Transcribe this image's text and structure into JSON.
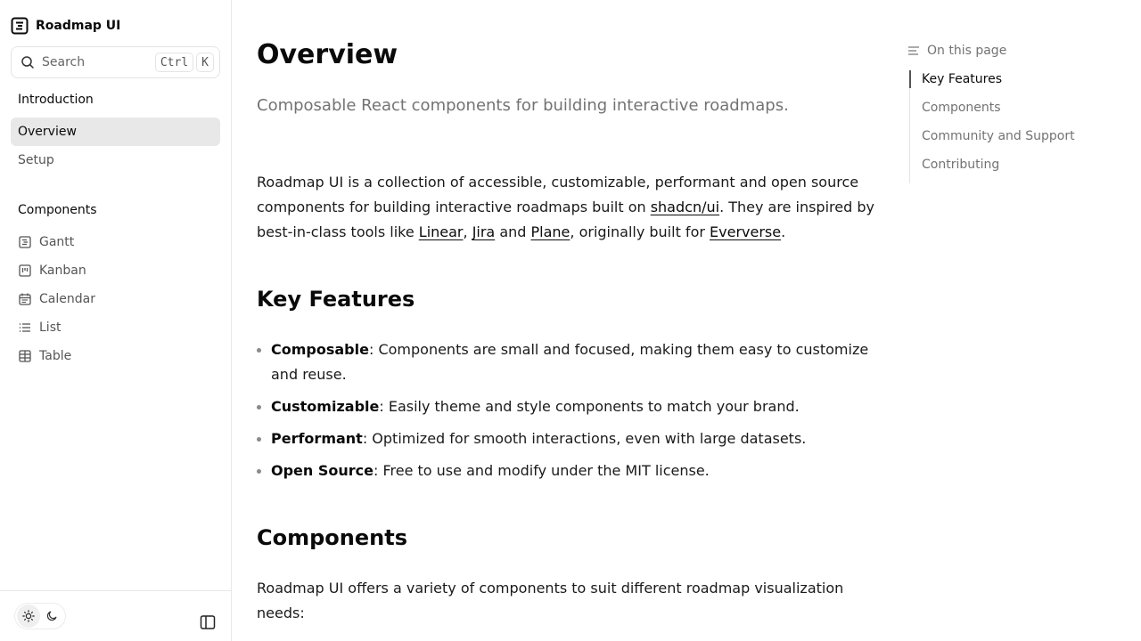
{
  "sidebar": {
    "brand": "Roadmap UI",
    "search": {
      "label": "Search",
      "shortcut": [
        "Ctrl",
        "K"
      ]
    },
    "sections": [
      {
        "title": "Introduction",
        "items": [
          {
            "label": "Overview",
            "active": true
          },
          {
            "label": "Setup",
            "active": false
          }
        ]
      },
      {
        "title": "Components",
        "items": [
          {
            "label": "Gantt",
            "icon": "gantt-icon"
          },
          {
            "label": "Kanban",
            "icon": "kanban-icon"
          },
          {
            "label": "Calendar",
            "icon": "calendar-icon"
          },
          {
            "label": "List",
            "icon": "list-icon"
          },
          {
            "label": "Table",
            "icon": "table-icon"
          }
        ]
      }
    ],
    "footer": {
      "theme_light": "sun-icon",
      "theme_dark": "moon-icon",
      "active_theme": "light"
    }
  },
  "main": {
    "title": "Overview",
    "subtitle": "Composable React components for building interactive roadmaps.",
    "intro": {
      "t1": "Roadmap UI is a collection of accessible, customizable, performant and open source components for building interactive roadmaps built on ",
      "link1": "shadcn/ui",
      "t2": ". They are inspired by best-in-class tools like ",
      "link2": "Linear",
      "t3": ", ",
      "link3": "Jira",
      "t4": " and ",
      "link4": "Plane",
      "t5": ", originally built for ",
      "link5": "Eververse",
      "t6": "."
    },
    "key_features": {
      "heading": "Key Features",
      "items": [
        {
          "name": "Composable",
          "desc": ": Components are small and focused, making them easy to customize and reuse."
        },
        {
          "name": "Customizable",
          "desc": ": Easily theme and style components to match your brand."
        },
        {
          "name": "Performant",
          "desc": ": Optimized for smooth interactions, even with large datasets."
        },
        {
          "name": "Open Source",
          "desc": ": Free to use and modify under the MIT license."
        }
      ]
    },
    "components": {
      "heading": "Components",
      "text": "Roadmap UI offers a variety of components to suit different roadmap visualization needs:"
    }
  },
  "toc": {
    "header": "On this page",
    "items": [
      {
        "label": "Key Features",
        "active": true
      },
      {
        "label": "Components",
        "active": false
      },
      {
        "label": "Community and Support",
        "active": false
      },
      {
        "label": "Contributing",
        "active": false
      }
    ]
  }
}
